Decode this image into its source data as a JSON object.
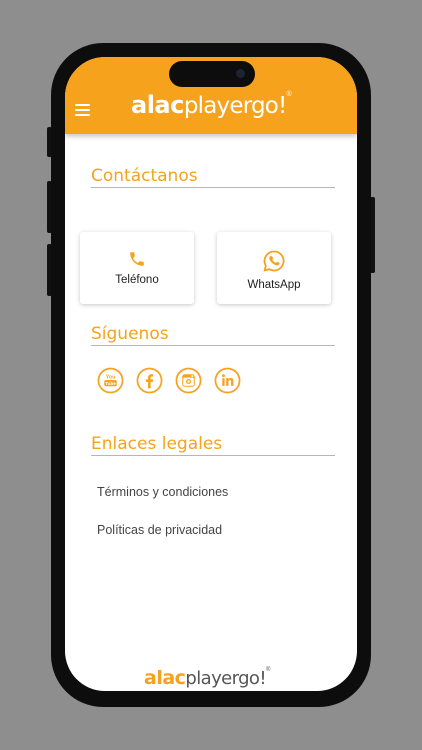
{
  "header": {
    "logo_bold": "alac",
    "logo_light": "playergo!",
    "logo_mark": "®"
  },
  "contact": {
    "title": "Contáctanos",
    "phone_label": "Teléfono",
    "whatsapp_label": "WhatsApp"
  },
  "follow": {
    "title": "Síguenos",
    "social": [
      "youtube-icon",
      "facebook-icon",
      "instagram-icon",
      "linkedin-icon"
    ]
  },
  "legal": {
    "title": "Enlaces legales",
    "links": [
      "Términos y condiciones",
      "Políticas de privacidad"
    ]
  },
  "footer": {
    "logo_bold": "alac",
    "logo_light": "playergo!",
    "logo_mark": "®"
  },
  "colors": {
    "accent": "#f7a21c",
    "background": "#8e8e8e",
    "screen": "#ffffff"
  }
}
